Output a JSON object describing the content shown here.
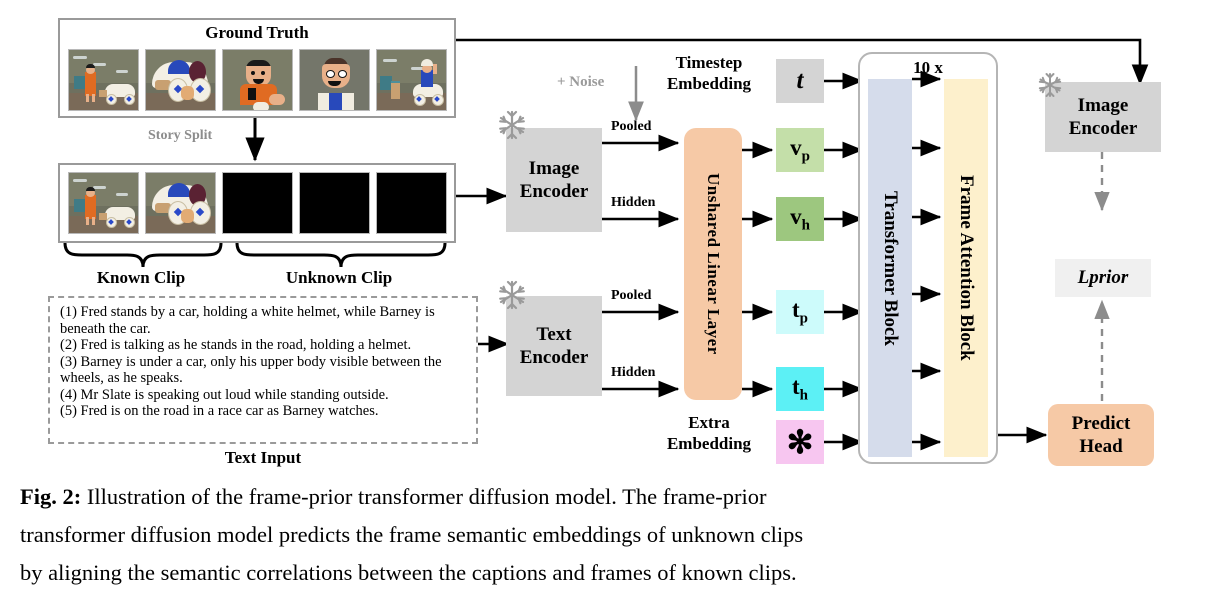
{
  "figure": {
    "label": "Fig. 2:",
    "caption_lines": [
      "Illustration of the frame-prior transformer diffusion model. The frame-prior",
      "transformer diffusion model predicts the frame semantic embeddings of unknown clips",
      "by aligning the semantic correlations between the captions and frames of known clips."
    ]
  },
  "ground_truth": {
    "title": "Ground Truth",
    "frame_count": 5
  },
  "split": {
    "label": "Story Split"
  },
  "clip_strip": {
    "known_frames": 2,
    "unknown_frames": 3,
    "known_label": "Known Clip",
    "unknown_label": "Unknown Clip"
  },
  "noise": {
    "label": "+ Noise"
  },
  "text_input": {
    "caption_label": "Text Input",
    "sentences": [
      "(1)  Fred stands by a car, holding a white helmet, while Barney is beneath the car.",
      "(2) Fred is talking as he stands in the road, holding a helmet.",
      "(3) Barney is under a car, only his upper body visible between the wheels, as he speaks.",
      "(4) Mr Slate is speaking out loud while standing outside.",
      "(5) Fred is on the road in a race car as Barney watches."
    ]
  },
  "encoders": {
    "image_encoder": {
      "line1": "Image",
      "line2": "Encoder",
      "frozen_icon": "snowflake-icon"
    },
    "text_encoder": {
      "line1": "Text",
      "line2": "Encoder",
      "frozen_icon": "snowflake-icon"
    },
    "right_image_encoder": {
      "line1": "Image",
      "line2": "Encoder",
      "frozen_icon": "snowflake-icon"
    }
  },
  "edge_labels": {
    "image_pooled": "Pooled",
    "image_hidden": "Hidden",
    "text_pooled": "Pooled",
    "text_hidden": "Hidden"
  },
  "linear_layer": {
    "label": "Unshared  Linear  Layer",
    "color": "#f6c9a6"
  },
  "timestep": {
    "label_line1": "Timestep",
    "label_line2": "Embedding",
    "token": "t",
    "color": "#d4d4d4"
  },
  "extra": {
    "label_line1": "Extra",
    "label_line2": "Embedding",
    "token": "✻",
    "color": "#f7c6f0"
  },
  "tokens": [
    {
      "name": "v_p",
      "base": "v",
      "sub": "p",
      "color": "#c4dfa9"
    },
    {
      "name": "v_h",
      "base": "v",
      "sub": "h",
      "color": "#9dc77f"
    },
    {
      "name": "t_p",
      "base": "t",
      "sub": "p",
      "color": "#cdfbfb"
    },
    {
      "name": "t_h",
      "base": "t",
      "sub": "h",
      "color": "#5cf0f5"
    }
  ],
  "transformer": {
    "repeat_label": "10 x",
    "block_label": "Transformer  Block",
    "block_color": "#d5dceb",
    "attention_label": "Frame Attention  Block",
    "attention_color": "#fdf0cc"
  },
  "predict_head": {
    "line1": "Predict",
    "line2": "Head",
    "color": "#f6c9a6"
  },
  "loss": {
    "label": "Lprior",
    "color": "#f0f0f0"
  }
}
